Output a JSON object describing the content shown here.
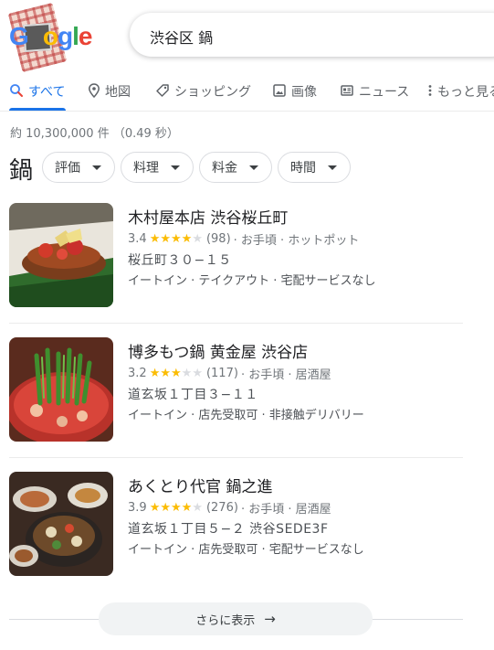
{
  "search": {
    "query": "渋谷区 鍋",
    "logo": "Google"
  },
  "tabs": [
    {
      "label": "すべて",
      "icon": "search-icon",
      "active": true
    },
    {
      "label": "地図",
      "icon": "map-pin-icon"
    },
    {
      "label": "ショッピング",
      "icon": "tag-icon"
    },
    {
      "label": "画像",
      "icon": "image-icon"
    },
    {
      "label": "ニュース",
      "icon": "news-icon"
    },
    {
      "label": "もっと見る",
      "icon": "more-vert-icon"
    }
  ],
  "result_stats": "約 10,300,000 件 （0.49 秒）",
  "filters": {
    "title": "鍋",
    "chips": [
      "評価",
      "料理",
      "料金",
      "時間"
    ]
  },
  "listings": [
    {
      "name": "木村屋本店 渋谷桜丘町",
      "rating": "3.4",
      "stars_value": 3.4,
      "reviews": "(98)",
      "details": "· お手頃 · ホットポット",
      "address": "桜丘町３０−１５",
      "services": "イートイン · テイクアウト · 宅配サービスなし"
    },
    {
      "name": "博多もつ鍋 黄金屋 渋谷店",
      "rating": "3.2",
      "stars_value": 3.2,
      "reviews": "(117)",
      "details": "· お手頃 · 居酒屋",
      "address": "道玄坂１丁目３−１１",
      "services": "イートイン · 店先受取可 · 非接触デリバリー"
    },
    {
      "name": "あくとり代官 鍋之進",
      "rating": "3.9",
      "stars_value": 3.9,
      "reviews": "(276)",
      "details": "· お手頃 · 居酒屋",
      "address": "道玄坂１丁目５−２ 渋谷SEDE3F",
      "services": "イートイン · 店先受取可 · 宅配サービスなし"
    }
  ],
  "more_button": {
    "label": "さらに表示",
    "icon": "arrow-right-icon"
  },
  "colors": {
    "accent": "#1a73e8",
    "star": "#fbbc04",
    "star_off": "#dadce0"
  }
}
